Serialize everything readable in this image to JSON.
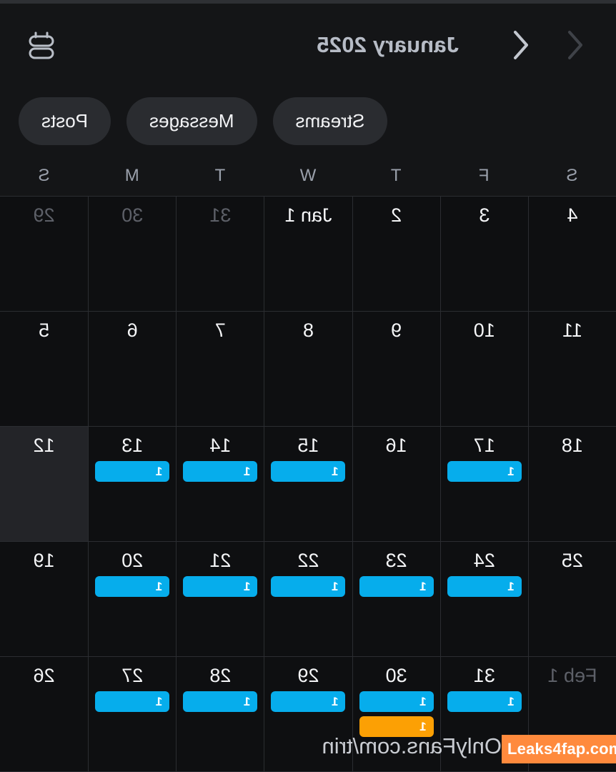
{
  "header": {
    "month_title": "January 2025",
    "prev_label": "‹",
    "next_label": "›",
    "view_icon_name": "agenda-view-icon"
  },
  "filters": {
    "items": [
      {
        "label": "Posts"
      },
      {
        "label": "Messages"
      },
      {
        "label": "Streams"
      }
    ]
  },
  "calendar": {
    "weekdays": [
      "S",
      "M",
      "T",
      "W",
      "T",
      "F",
      "S"
    ],
    "weeks": [
      [
        {
          "day": "29",
          "muted": true,
          "today": false,
          "badges": []
        },
        {
          "day": "30",
          "muted": true,
          "today": false,
          "badges": []
        },
        {
          "day": "31",
          "muted": true,
          "today": false,
          "badges": []
        },
        {
          "day": "Jan 1",
          "muted": false,
          "today": false,
          "badges": []
        },
        {
          "day": "2",
          "muted": false,
          "today": false,
          "badges": []
        },
        {
          "day": "3",
          "muted": false,
          "today": false,
          "badges": []
        },
        {
          "day": "4",
          "muted": false,
          "today": false,
          "badges": []
        }
      ],
      [
        {
          "day": "5",
          "muted": false,
          "today": false,
          "badges": []
        },
        {
          "day": "6",
          "muted": false,
          "today": false,
          "badges": []
        },
        {
          "day": "7",
          "muted": false,
          "today": false,
          "badges": []
        },
        {
          "day": "8",
          "muted": false,
          "today": false,
          "badges": []
        },
        {
          "day": "9",
          "muted": false,
          "today": false,
          "badges": []
        },
        {
          "day": "10",
          "muted": false,
          "today": false,
          "badges": []
        },
        {
          "day": "11",
          "muted": false,
          "today": false,
          "badges": []
        }
      ],
      [
        {
          "day": "12",
          "muted": false,
          "today": true,
          "badges": []
        },
        {
          "day": "13",
          "muted": false,
          "today": false,
          "badges": [
            {
              "count": "1",
              "color": "blue"
            }
          ]
        },
        {
          "day": "14",
          "muted": false,
          "today": false,
          "badges": [
            {
              "count": "1",
              "color": "blue"
            }
          ]
        },
        {
          "day": "15",
          "muted": false,
          "today": false,
          "badges": [
            {
              "count": "1",
              "color": "blue"
            }
          ]
        },
        {
          "day": "16",
          "muted": false,
          "today": false,
          "badges": []
        },
        {
          "day": "17",
          "muted": false,
          "today": false,
          "badges": [
            {
              "count": "1",
              "color": "blue"
            }
          ]
        },
        {
          "day": "18",
          "muted": false,
          "today": false,
          "badges": []
        }
      ],
      [
        {
          "day": "19",
          "muted": false,
          "today": false,
          "badges": []
        },
        {
          "day": "20",
          "muted": false,
          "today": false,
          "badges": [
            {
              "count": "1",
              "color": "blue"
            }
          ]
        },
        {
          "day": "21",
          "muted": false,
          "today": false,
          "badges": [
            {
              "count": "1",
              "color": "blue"
            }
          ]
        },
        {
          "day": "22",
          "muted": false,
          "today": false,
          "badges": [
            {
              "count": "1",
              "color": "blue"
            }
          ]
        },
        {
          "day": "23",
          "muted": false,
          "today": false,
          "badges": [
            {
              "count": "1",
              "color": "blue"
            }
          ]
        },
        {
          "day": "24",
          "muted": false,
          "today": false,
          "badges": [
            {
              "count": "1",
              "color": "blue"
            }
          ]
        },
        {
          "day": "25",
          "muted": false,
          "today": false,
          "badges": []
        }
      ],
      [
        {
          "day": "26",
          "muted": false,
          "today": false,
          "badges": []
        },
        {
          "day": "27",
          "muted": false,
          "today": false,
          "badges": [
            {
              "count": "1",
              "color": "blue"
            }
          ]
        },
        {
          "day": "28",
          "muted": false,
          "today": false,
          "badges": [
            {
              "count": "1",
              "color": "blue"
            }
          ]
        },
        {
          "day": "29",
          "muted": false,
          "today": false,
          "badges": [
            {
              "count": "1",
              "color": "blue"
            }
          ]
        },
        {
          "day": "30",
          "muted": false,
          "today": false,
          "badges": [
            {
              "count": "1",
              "color": "blue"
            },
            {
              "count": "1",
              "color": "orange"
            }
          ]
        },
        {
          "day": "31",
          "muted": false,
          "today": false,
          "badges": [
            {
              "count": "1",
              "color": "blue"
            }
          ]
        },
        {
          "day": "Feb 1",
          "muted": true,
          "today": false,
          "badges": []
        }
      ]
    ]
  },
  "footer": {
    "url_text": "OnlyFans.com/trin"
  },
  "watermark": {
    "text": "Leaks4fap.com"
  },
  "colors": {
    "badge_blue": "#06adec",
    "badge_orange": "#fca004",
    "background": "#141517",
    "grid_background": "#0e0f11",
    "grid_line": "#2b2d31",
    "today_cell": "#232428",
    "pill_background": "#2a2c30",
    "watermark_background": "#ff8a3d"
  }
}
